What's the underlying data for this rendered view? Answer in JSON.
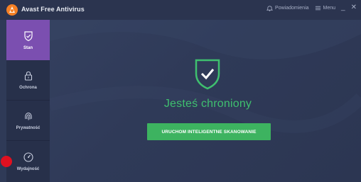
{
  "app": {
    "title": "Avast Free Antivirus",
    "notifications_label": "Powiadomienia",
    "menu_label": "Menu",
    "minimize_glyph": "_",
    "close_glyph": "✕"
  },
  "sidebar": {
    "items": [
      {
        "label": "Stan",
        "icon": "shield-check-icon",
        "active": true
      },
      {
        "label": "Ochrona",
        "icon": "lock-icon",
        "active": false
      },
      {
        "label": "Prywatność",
        "icon": "fingerprint-icon",
        "active": false
      },
      {
        "label": "Wydajność",
        "icon": "speedometer-icon",
        "active": false
      }
    ]
  },
  "main": {
    "status_text": "Jesteś chroniony",
    "scan_button_label": "URUCHOM INTELIGENTNE SKANOWANIE"
  },
  "colors": {
    "background": "#2f3a57",
    "sidebar": "#27304a",
    "active_item": "#7b4fb0",
    "accent_green": "#3fc06f",
    "button_green": "#3db360",
    "annotation_dot": "#e01020"
  }
}
